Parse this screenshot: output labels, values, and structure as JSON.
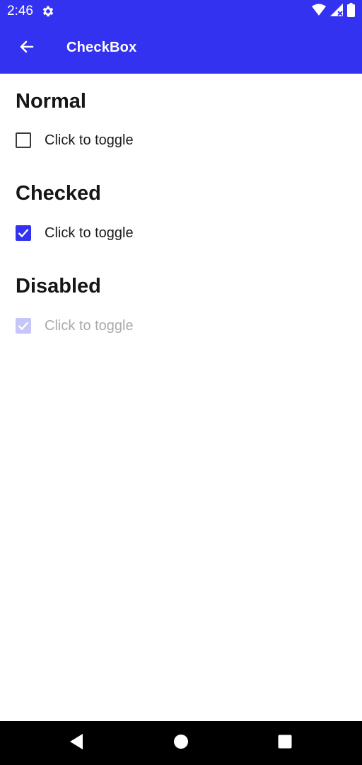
{
  "status_bar": {
    "time": "2:46",
    "icons": [
      "settings-gear-icon",
      "wifi-icon",
      "signal-icon",
      "battery-icon"
    ]
  },
  "app_bar": {
    "title": "CheckBox",
    "back_icon": "back-arrow-icon",
    "color": "#3232f0"
  },
  "sections": [
    {
      "heading": "Normal",
      "checkbox_label": "Click to toggle",
      "checked": false,
      "enabled": true
    },
    {
      "heading": "Checked",
      "checkbox_label": "Click to toggle",
      "checked": true,
      "enabled": true
    },
    {
      "heading": "Disabled",
      "checkbox_label": "Click to toggle",
      "checked": true,
      "enabled": false
    }
  ],
  "nav_bar": {
    "buttons": [
      "back-triangle-icon",
      "home-circle-icon",
      "recents-square-icon"
    ]
  }
}
